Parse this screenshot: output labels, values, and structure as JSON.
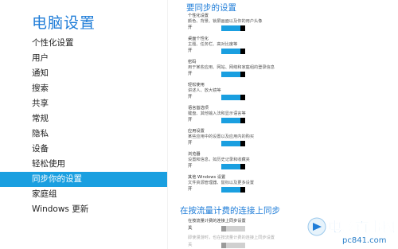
{
  "sidebar": {
    "title": "电脑设置",
    "items": [
      {
        "label": "个性化设置",
        "selected": false
      },
      {
        "label": "用户",
        "selected": false
      },
      {
        "label": "通知",
        "selected": false
      },
      {
        "label": "搜索",
        "selected": false
      },
      {
        "label": "共享",
        "selected": false
      },
      {
        "label": "常规",
        "selected": false
      },
      {
        "label": "隐私",
        "selected": false
      },
      {
        "label": "设备",
        "selected": false
      },
      {
        "label": "轻松使用",
        "selected": false
      },
      {
        "label": "同步你的设置",
        "selected": true
      },
      {
        "label": "家庭组",
        "selected": false
      },
      {
        "label": "Windows 更新",
        "selected": false
      }
    ]
  },
  "main": {
    "section1_title": "要同步的设置",
    "settings": [
      {
        "name": "个性化设置",
        "desc": "颜色、背景、锁屏画面以及你的用户头像",
        "state": "开",
        "on": true
      },
      {
        "name": "桌面个性化",
        "desc": "主题、任务栏、高对比度等",
        "state": "开",
        "on": true
      },
      {
        "name": "密码",
        "desc": "用于某些应用、网站、网络和家庭组的登录信息",
        "state": "开",
        "on": true
      },
      {
        "name": "轻松使用",
        "desc": "讲述人、放大镜等",
        "state": "开",
        "on": true
      },
      {
        "name": "语言首选项",
        "desc": "键盘、其他输入法和显示语言等",
        "state": "开",
        "on": true
      },
      {
        "name": "应用设置",
        "desc": "某些应用中的设置以及应用内的购买",
        "state": "开",
        "on": true
      },
      {
        "name": "浏览器",
        "desc": "设置和信息，如历史记录和收藏夹",
        "state": "开",
        "on": true
      },
      {
        "name": "其他 Windows 设置",
        "desc": "文件资源管理器、鼠标以及更多设置",
        "state": "开",
        "on": true
      }
    ],
    "section2_title": "在按流量计费的连接上同步",
    "metered": [
      {
        "name": "在按流量计费的连接上同步设置",
        "state": "关",
        "on": false,
        "disabled": false
      },
      {
        "name": "即使漫游时，也在按流量计费的连接上同步设置",
        "state": "关",
        "on": false,
        "disabled": true
      }
    ]
  },
  "watermark": {
    "text": "电脑百事网",
    "sub": "pc841.com"
  },
  "colors": {
    "accent": "#1a9fe0",
    "title": "#1f7dd8"
  }
}
